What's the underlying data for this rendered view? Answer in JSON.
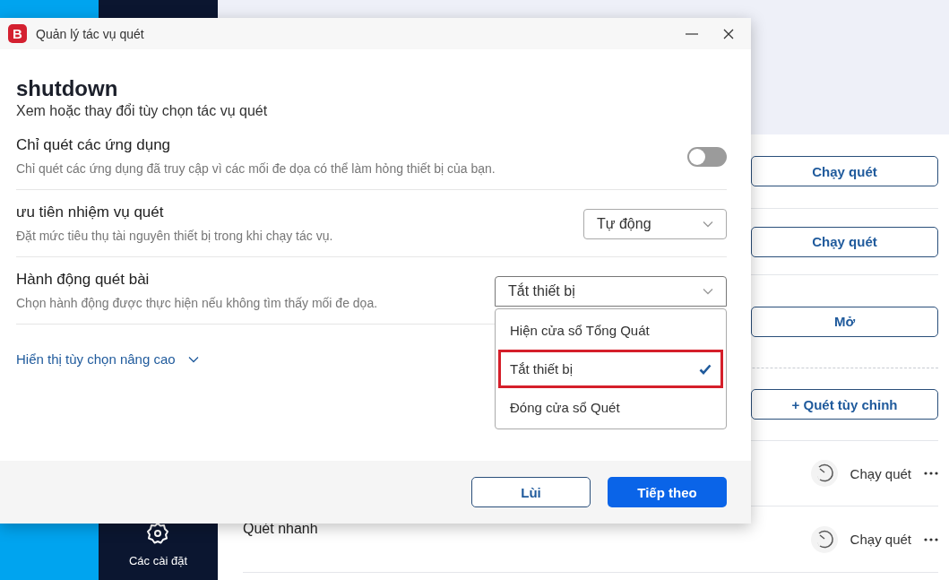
{
  "app": {
    "sidebar": {
      "items": [
        {
          "label": "Các cài đặt"
        }
      ]
    },
    "rows": [
      {
        "kind": "button",
        "label": "Chạy quét"
      },
      {
        "kind": "button",
        "label": "Chạy quét"
      },
      {
        "kind": "button",
        "label": "Mở"
      },
      {
        "kind": "button",
        "label": "+ Quét tùy chỉnh"
      },
      {
        "kind": "scan",
        "label": "Chạy quét"
      },
      {
        "kind": "scan",
        "name": "Quét nhanh",
        "label": "Chạy quét"
      }
    ]
  },
  "dialog": {
    "title": "Quản lý tác vụ quét",
    "logo": "B",
    "heading": "shutdown",
    "subtitle": "Xem hoặc thay đổi tùy chọn tác vụ quét",
    "settings": [
      {
        "kind": "toggle",
        "title": "Chỉ quét các ứng dụng",
        "description": "Chỉ quét các ứng dụng đã truy cập vì các mối đe dọa có thể làm hỏng thiết bị của bạn.",
        "on": false
      },
      {
        "kind": "select",
        "title": "ưu tiên nhiệm vụ quét",
        "description": "Đặt mức tiêu thụ tài nguyên thiết bị trong khi chạy tác vụ.",
        "value": "Tự động"
      },
      {
        "kind": "select",
        "title": "Hành động quét bài",
        "description": "Chọn hành động được thực hiện nếu không tìm thấy mối đe dọa.",
        "value": "Tắt thiết bị",
        "expanded": true,
        "options": [
          {
            "label": "Hiện cửa sổ Tổng Quát",
            "selected": false
          },
          {
            "label": "Tắt thiết bị",
            "selected": true
          },
          {
            "label": "Đóng cửa sổ Quét",
            "selected": false
          }
        ]
      }
    ],
    "advanced_link": "Hiển thị tùy chọn nâng cao",
    "buttons": [
      {
        "kind": "secondary",
        "label": "Lùi"
      },
      {
        "kind": "primary",
        "label": "Tiếp theo"
      }
    ]
  }
}
